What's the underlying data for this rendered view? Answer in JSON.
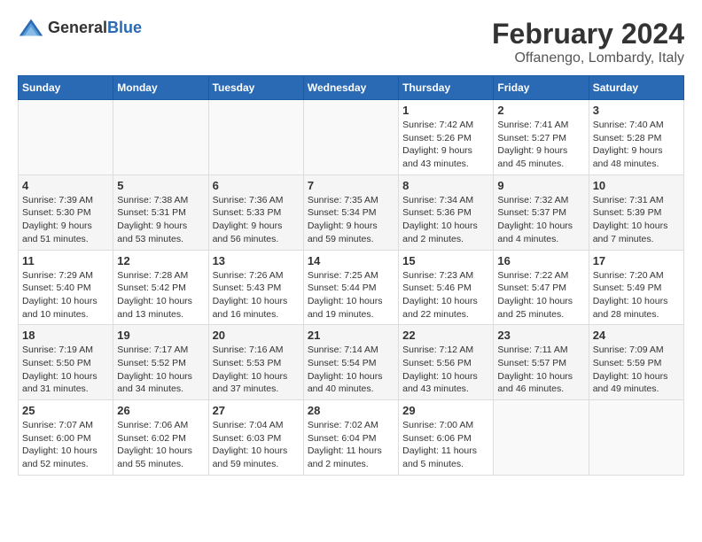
{
  "header": {
    "logo_general": "General",
    "logo_blue": "Blue",
    "month_title": "February 2024",
    "location": "Offanengo, Lombardy, Italy"
  },
  "weekdays": [
    "Sunday",
    "Monday",
    "Tuesday",
    "Wednesday",
    "Thursday",
    "Friday",
    "Saturday"
  ],
  "weeks": [
    [
      {
        "day": "",
        "info": ""
      },
      {
        "day": "",
        "info": ""
      },
      {
        "day": "",
        "info": ""
      },
      {
        "day": "",
        "info": ""
      },
      {
        "day": "1",
        "info": "Sunrise: 7:42 AM\nSunset: 5:26 PM\nDaylight: 9 hours\nand 43 minutes."
      },
      {
        "day": "2",
        "info": "Sunrise: 7:41 AM\nSunset: 5:27 PM\nDaylight: 9 hours\nand 45 minutes."
      },
      {
        "day": "3",
        "info": "Sunrise: 7:40 AM\nSunset: 5:28 PM\nDaylight: 9 hours\nand 48 minutes."
      }
    ],
    [
      {
        "day": "4",
        "info": "Sunrise: 7:39 AM\nSunset: 5:30 PM\nDaylight: 9 hours\nand 51 minutes."
      },
      {
        "day": "5",
        "info": "Sunrise: 7:38 AM\nSunset: 5:31 PM\nDaylight: 9 hours\nand 53 minutes."
      },
      {
        "day": "6",
        "info": "Sunrise: 7:36 AM\nSunset: 5:33 PM\nDaylight: 9 hours\nand 56 minutes."
      },
      {
        "day": "7",
        "info": "Sunrise: 7:35 AM\nSunset: 5:34 PM\nDaylight: 9 hours\nand 59 minutes."
      },
      {
        "day": "8",
        "info": "Sunrise: 7:34 AM\nSunset: 5:36 PM\nDaylight: 10 hours\nand 2 minutes."
      },
      {
        "day": "9",
        "info": "Sunrise: 7:32 AM\nSunset: 5:37 PM\nDaylight: 10 hours\nand 4 minutes."
      },
      {
        "day": "10",
        "info": "Sunrise: 7:31 AM\nSunset: 5:39 PM\nDaylight: 10 hours\nand 7 minutes."
      }
    ],
    [
      {
        "day": "11",
        "info": "Sunrise: 7:29 AM\nSunset: 5:40 PM\nDaylight: 10 hours\nand 10 minutes."
      },
      {
        "day": "12",
        "info": "Sunrise: 7:28 AM\nSunset: 5:42 PM\nDaylight: 10 hours\nand 13 minutes."
      },
      {
        "day": "13",
        "info": "Sunrise: 7:26 AM\nSunset: 5:43 PM\nDaylight: 10 hours\nand 16 minutes."
      },
      {
        "day": "14",
        "info": "Sunrise: 7:25 AM\nSunset: 5:44 PM\nDaylight: 10 hours\nand 19 minutes."
      },
      {
        "day": "15",
        "info": "Sunrise: 7:23 AM\nSunset: 5:46 PM\nDaylight: 10 hours\nand 22 minutes."
      },
      {
        "day": "16",
        "info": "Sunrise: 7:22 AM\nSunset: 5:47 PM\nDaylight: 10 hours\nand 25 minutes."
      },
      {
        "day": "17",
        "info": "Sunrise: 7:20 AM\nSunset: 5:49 PM\nDaylight: 10 hours\nand 28 minutes."
      }
    ],
    [
      {
        "day": "18",
        "info": "Sunrise: 7:19 AM\nSunset: 5:50 PM\nDaylight: 10 hours\nand 31 minutes."
      },
      {
        "day": "19",
        "info": "Sunrise: 7:17 AM\nSunset: 5:52 PM\nDaylight: 10 hours\nand 34 minutes."
      },
      {
        "day": "20",
        "info": "Sunrise: 7:16 AM\nSunset: 5:53 PM\nDaylight: 10 hours\nand 37 minutes."
      },
      {
        "day": "21",
        "info": "Sunrise: 7:14 AM\nSunset: 5:54 PM\nDaylight: 10 hours\nand 40 minutes."
      },
      {
        "day": "22",
        "info": "Sunrise: 7:12 AM\nSunset: 5:56 PM\nDaylight: 10 hours\nand 43 minutes."
      },
      {
        "day": "23",
        "info": "Sunrise: 7:11 AM\nSunset: 5:57 PM\nDaylight: 10 hours\nand 46 minutes."
      },
      {
        "day": "24",
        "info": "Sunrise: 7:09 AM\nSunset: 5:59 PM\nDaylight: 10 hours\nand 49 minutes."
      }
    ],
    [
      {
        "day": "25",
        "info": "Sunrise: 7:07 AM\nSunset: 6:00 PM\nDaylight: 10 hours\nand 52 minutes."
      },
      {
        "day": "26",
        "info": "Sunrise: 7:06 AM\nSunset: 6:02 PM\nDaylight: 10 hours\nand 55 minutes."
      },
      {
        "day": "27",
        "info": "Sunrise: 7:04 AM\nSunset: 6:03 PM\nDaylight: 10 hours\nand 59 minutes."
      },
      {
        "day": "28",
        "info": "Sunrise: 7:02 AM\nSunset: 6:04 PM\nDaylight: 11 hours\nand 2 minutes."
      },
      {
        "day": "29",
        "info": "Sunrise: 7:00 AM\nSunset: 6:06 PM\nDaylight: 11 hours\nand 5 minutes."
      },
      {
        "day": "",
        "info": ""
      },
      {
        "day": "",
        "info": ""
      }
    ]
  ]
}
